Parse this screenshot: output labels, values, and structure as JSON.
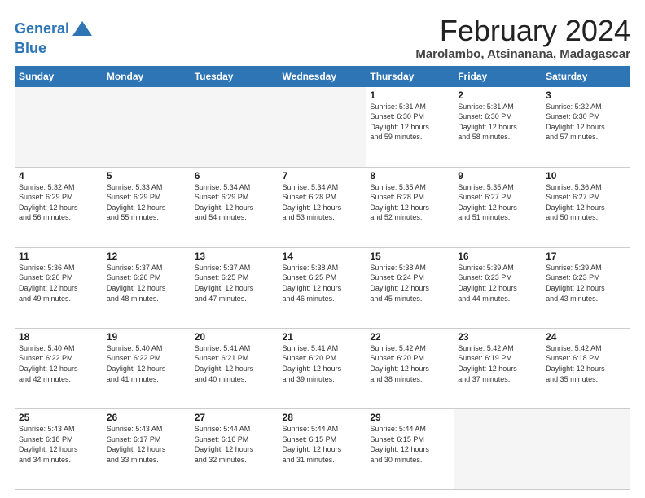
{
  "logo": {
    "line1": "General",
    "line2": "Blue"
  },
  "title": "February 2024",
  "subtitle": "Marolambo, Atsinanana, Madagascar",
  "days_header": [
    "Sunday",
    "Monday",
    "Tuesday",
    "Wednesday",
    "Thursday",
    "Friday",
    "Saturday"
  ],
  "weeks": [
    [
      {
        "day": "",
        "info": ""
      },
      {
        "day": "",
        "info": ""
      },
      {
        "day": "",
        "info": ""
      },
      {
        "day": "",
        "info": ""
      },
      {
        "day": "1",
        "info": "Sunrise: 5:31 AM\nSunset: 6:30 PM\nDaylight: 12 hours\nand 59 minutes."
      },
      {
        "day": "2",
        "info": "Sunrise: 5:31 AM\nSunset: 6:30 PM\nDaylight: 12 hours\nand 58 minutes."
      },
      {
        "day": "3",
        "info": "Sunrise: 5:32 AM\nSunset: 6:30 PM\nDaylight: 12 hours\nand 57 minutes."
      }
    ],
    [
      {
        "day": "4",
        "info": "Sunrise: 5:32 AM\nSunset: 6:29 PM\nDaylight: 12 hours\nand 56 minutes."
      },
      {
        "day": "5",
        "info": "Sunrise: 5:33 AM\nSunset: 6:29 PM\nDaylight: 12 hours\nand 55 minutes."
      },
      {
        "day": "6",
        "info": "Sunrise: 5:34 AM\nSunset: 6:29 PM\nDaylight: 12 hours\nand 54 minutes."
      },
      {
        "day": "7",
        "info": "Sunrise: 5:34 AM\nSunset: 6:28 PM\nDaylight: 12 hours\nand 53 minutes."
      },
      {
        "day": "8",
        "info": "Sunrise: 5:35 AM\nSunset: 6:28 PM\nDaylight: 12 hours\nand 52 minutes."
      },
      {
        "day": "9",
        "info": "Sunrise: 5:35 AM\nSunset: 6:27 PM\nDaylight: 12 hours\nand 51 minutes."
      },
      {
        "day": "10",
        "info": "Sunrise: 5:36 AM\nSunset: 6:27 PM\nDaylight: 12 hours\nand 50 minutes."
      }
    ],
    [
      {
        "day": "11",
        "info": "Sunrise: 5:36 AM\nSunset: 6:26 PM\nDaylight: 12 hours\nand 49 minutes."
      },
      {
        "day": "12",
        "info": "Sunrise: 5:37 AM\nSunset: 6:26 PM\nDaylight: 12 hours\nand 48 minutes."
      },
      {
        "day": "13",
        "info": "Sunrise: 5:37 AM\nSunset: 6:25 PM\nDaylight: 12 hours\nand 47 minutes."
      },
      {
        "day": "14",
        "info": "Sunrise: 5:38 AM\nSunset: 6:25 PM\nDaylight: 12 hours\nand 46 minutes."
      },
      {
        "day": "15",
        "info": "Sunrise: 5:38 AM\nSunset: 6:24 PM\nDaylight: 12 hours\nand 45 minutes."
      },
      {
        "day": "16",
        "info": "Sunrise: 5:39 AM\nSunset: 6:23 PM\nDaylight: 12 hours\nand 44 minutes."
      },
      {
        "day": "17",
        "info": "Sunrise: 5:39 AM\nSunset: 6:23 PM\nDaylight: 12 hours\nand 43 minutes."
      }
    ],
    [
      {
        "day": "18",
        "info": "Sunrise: 5:40 AM\nSunset: 6:22 PM\nDaylight: 12 hours\nand 42 minutes."
      },
      {
        "day": "19",
        "info": "Sunrise: 5:40 AM\nSunset: 6:22 PM\nDaylight: 12 hours\nand 41 minutes."
      },
      {
        "day": "20",
        "info": "Sunrise: 5:41 AM\nSunset: 6:21 PM\nDaylight: 12 hours\nand 40 minutes."
      },
      {
        "day": "21",
        "info": "Sunrise: 5:41 AM\nSunset: 6:20 PM\nDaylight: 12 hours\nand 39 minutes."
      },
      {
        "day": "22",
        "info": "Sunrise: 5:42 AM\nSunset: 6:20 PM\nDaylight: 12 hours\nand 38 minutes."
      },
      {
        "day": "23",
        "info": "Sunrise: 5:42 AM\nSunset: 6:19 PM\nDaylight: 12 hours\nand 37 minutes."
      },
      {
        "day": "24",
        "info": "Sunrise: 5:42 AM\nSunset: 6:18 PM\nDaylight: 12 hours\nand 35 minutes."
      }
    ],
    [
      {
        "day": "25",
        "info": "Sunrise: 5:43 AM\nSunset: 6:18 PM\nDaylight: 12 hours\nand 34 minutes."
      },
      {
        "day": "26",
        "info": "Sunrise: 5:43 AM\nSunset: 6:17 PM\nDaylight: 12 hours\nand 33 minutes."
      },
      {
        "day": "27",
        "info": "Sunrise: 5:44 AM\nSunset: 6:16 PM\nDaylight: 12 hours\nand 32 minutes."
      },
      {
        "day": "28",
        "info": "Sunrise: 5:44 AM\nSunset: 6:15 PM\nDaylight: 12 hours\nand 31 minutes."
      },
      {
        "day": "29",
        "info": "Sunrise: 5:44 AM\nSunset: 6:15 PM\nDaylight: 12 hours\nand 30 minutes."
      },
      {
        "day": "",
        "info": ""
      },
      {
        "day": "",
        "info": ""
      }
    ]
  ]
}
